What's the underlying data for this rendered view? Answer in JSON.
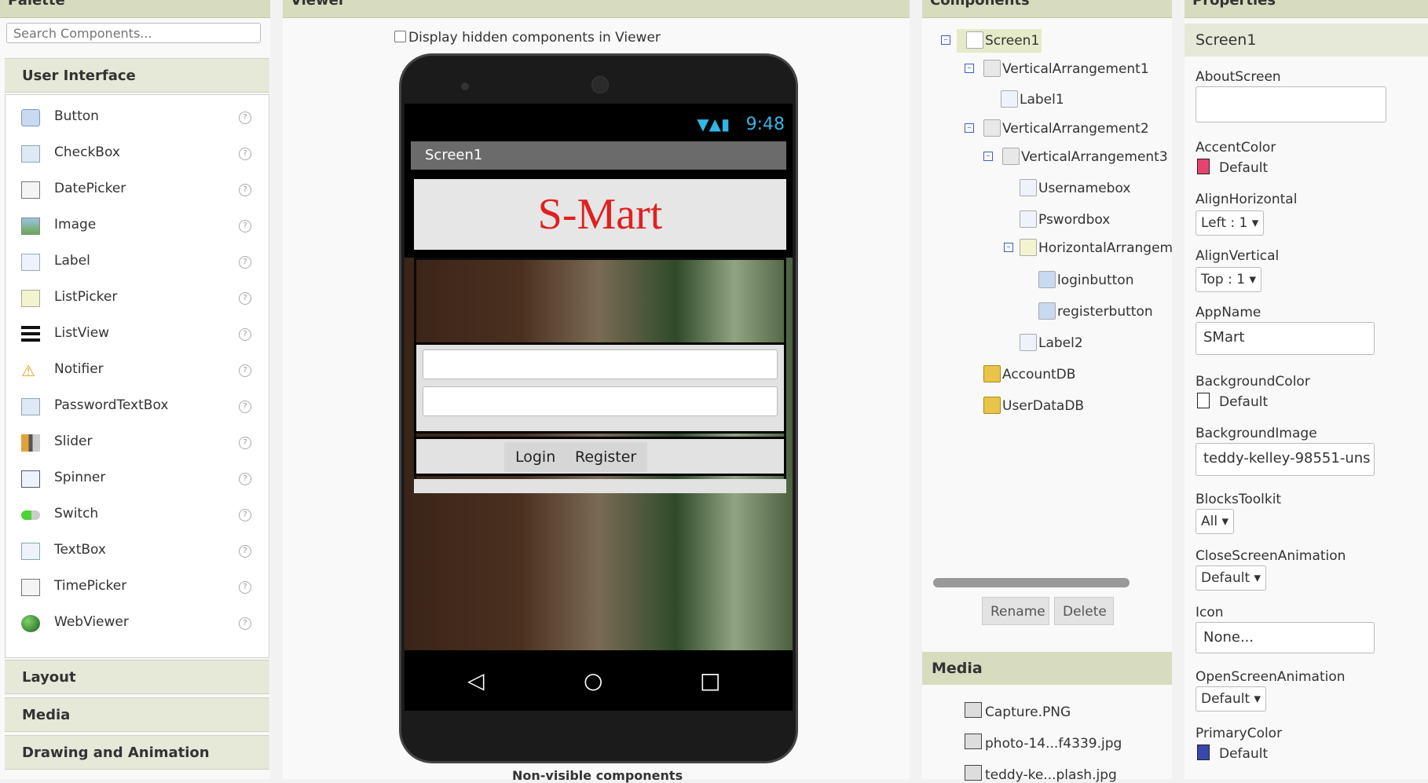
{
  "palette": {
    "title": "Palette",
    "search_placeholder": "Search Components...",
    "sections": [
      "User Interface",
      "Layout",
      "Media",
      "Drawing and Animation"
    ],
    "items": [
      {
        "label": "Button",
        "icon": "button-icon"
      },
      {
        "label": "CheckBox",
        "icon": "checkbox-icon"
      },
      {
        "label": "DatePicker",
        "icon": "datepicker-icon"
      },
      {
        "label": "Image",
        "icon": "image-icon"
      },
      {
        "label": "Label",
        "icon": "label-icon"
      },
      {
        "label": "ListPicker",
        "icon": "listpicker-icon"
      },
      {
        "label": "ListView",
        "icon": "listview-icon"
      },
      {
        "label": "Notifier",
        "icon": "notifier-icon"
      },
      {
        "label": "PasswordTextBox",
        "icon": "passwordtextbox-icon"
      },
      {
        "label": "Slider",
        "icon": "slider-icon"
      },
      {
        "label": "Spinner",
        "icon": "spinner-icon"
      },
      {
        "label": "Switch",
        "icon": "switch-icon"
      },
      {
        "label": "TextBox",
        "icon": "textbox-icon"
      },
      {
        "label": "TimePicker",
        "icon": "timepicker-icon"
      },
      {
        "label": "WebViewer",
        "icon": "webviewer-icon"
      }
    ],
    "help_glyph": "?"
  },
  "viewer": {
    "title": "Viewer",
    "hidden_checkbox_label": "Display hidden components in Viewer",
    "status_time": "9:48",
    "screen_title": "Screen1",
    "app_banner": "S-Mart",
    "login_label": "Login",
    "register_label": "Register",
    "non_visible_label": "Non-visible components"
  },
  "components": {
    "title": "Components",
    "tree": [
      {
        "label": "Screen1",
        "depth": 0,
        "toggle": true,
        "selected": true
      },
      {
        "label": "VerticalArrangement1",
        "depth": 1,
        "toggle": true
      },
      {
        "label": "Label1",
        "depth": 2,
        "toggle": false
      },
      {
        "label": "VerticalArrangement2",
        "depth": 1,
        "toggle": true
      },
      {
        "label": "VerticalArrangement3",
        "depth": 2,
        "toggle": true
      },
      {
        "label": "Usernamebox",
        "depth": 3,
        "toggle": false
      },
      {
        "label": "Pswordbox",
        "depth": 3,
        "toggle": false
      },
      {
        "label": "HorizontalArrangem",
        "depth": 3,
        "toggle": true
      },
      {
        "label": "loginbutton",
        "depth": 4,
        "toggle": false
      },
      {
        "label": "registerbutton",
        "depth": 4,
        "toggle": false
      },
      {
        "label": "Label2",
        "depth": 3,
        "toggle": false
      },
      {
        "label": "AccountDB",
        "depth": 2,
        "toggle": false
      },
      {
        "label": "UserDataDB",
        "depth": 2,
        "toggle": false
      }
    ],
    "rename_label": "Rename",
    "delete_label": "Delete"
  },
  "media": {
    "title": "Media",
    "files": [
      "Capture.PNG",
      "photo-14...f4339.jpg",
      "teddy-ke...plash.jpg"
    ]
  },
  "properties": {
    "title": "Properties",
    "component": "Screen1",
    "about_screen_label": "AboutScreen",
    "about_screen_value": "",
    "accent_color_label": "AccentColor",
    "accent_color_value": "Default",
    "accent_color_hex": "#e8436e",
    "align_horizontal_label": "AlignHorizontal",
    "align_horizontal_value": "Left : 1",
    "align_vertical_label": "AlignVertical",
    "align_vertical_value": "Top : 1",
    "app_name_label": "AppName",
    "app_name_value": "SMart",
    "background_color_label": "BackgroundColor",
    "background_color_value": "Default",
    "background_color_hex": "#ffffff",
    "background_image_label": "BackgroundImage",
    "background_image_value": "teddy-kelley-98551-uns",
    "blocks_toolkit_label": "BlocksToolkit",
    "blocks_toolkit_value": "All",
    "close_anim_label": "CloseScreenAnimation",
    "close_anim_value": "Default",
    "icon_label": "Icon",
    "icon_value": "None...",
    "open_anim_label": "OpenScreenAnimation",
    "open_anim_value": "Default",
    "primary_color_label": "PrimaryColor",
    "primary_color_value": "Default",
    "primary_color_hex": "#3949ab"
  },
  "colors": {
    "header_bg": "#d7dcbf",
    "banner_text": "#e02020",
    "status_blue": "#33b5e5"
  }
}
